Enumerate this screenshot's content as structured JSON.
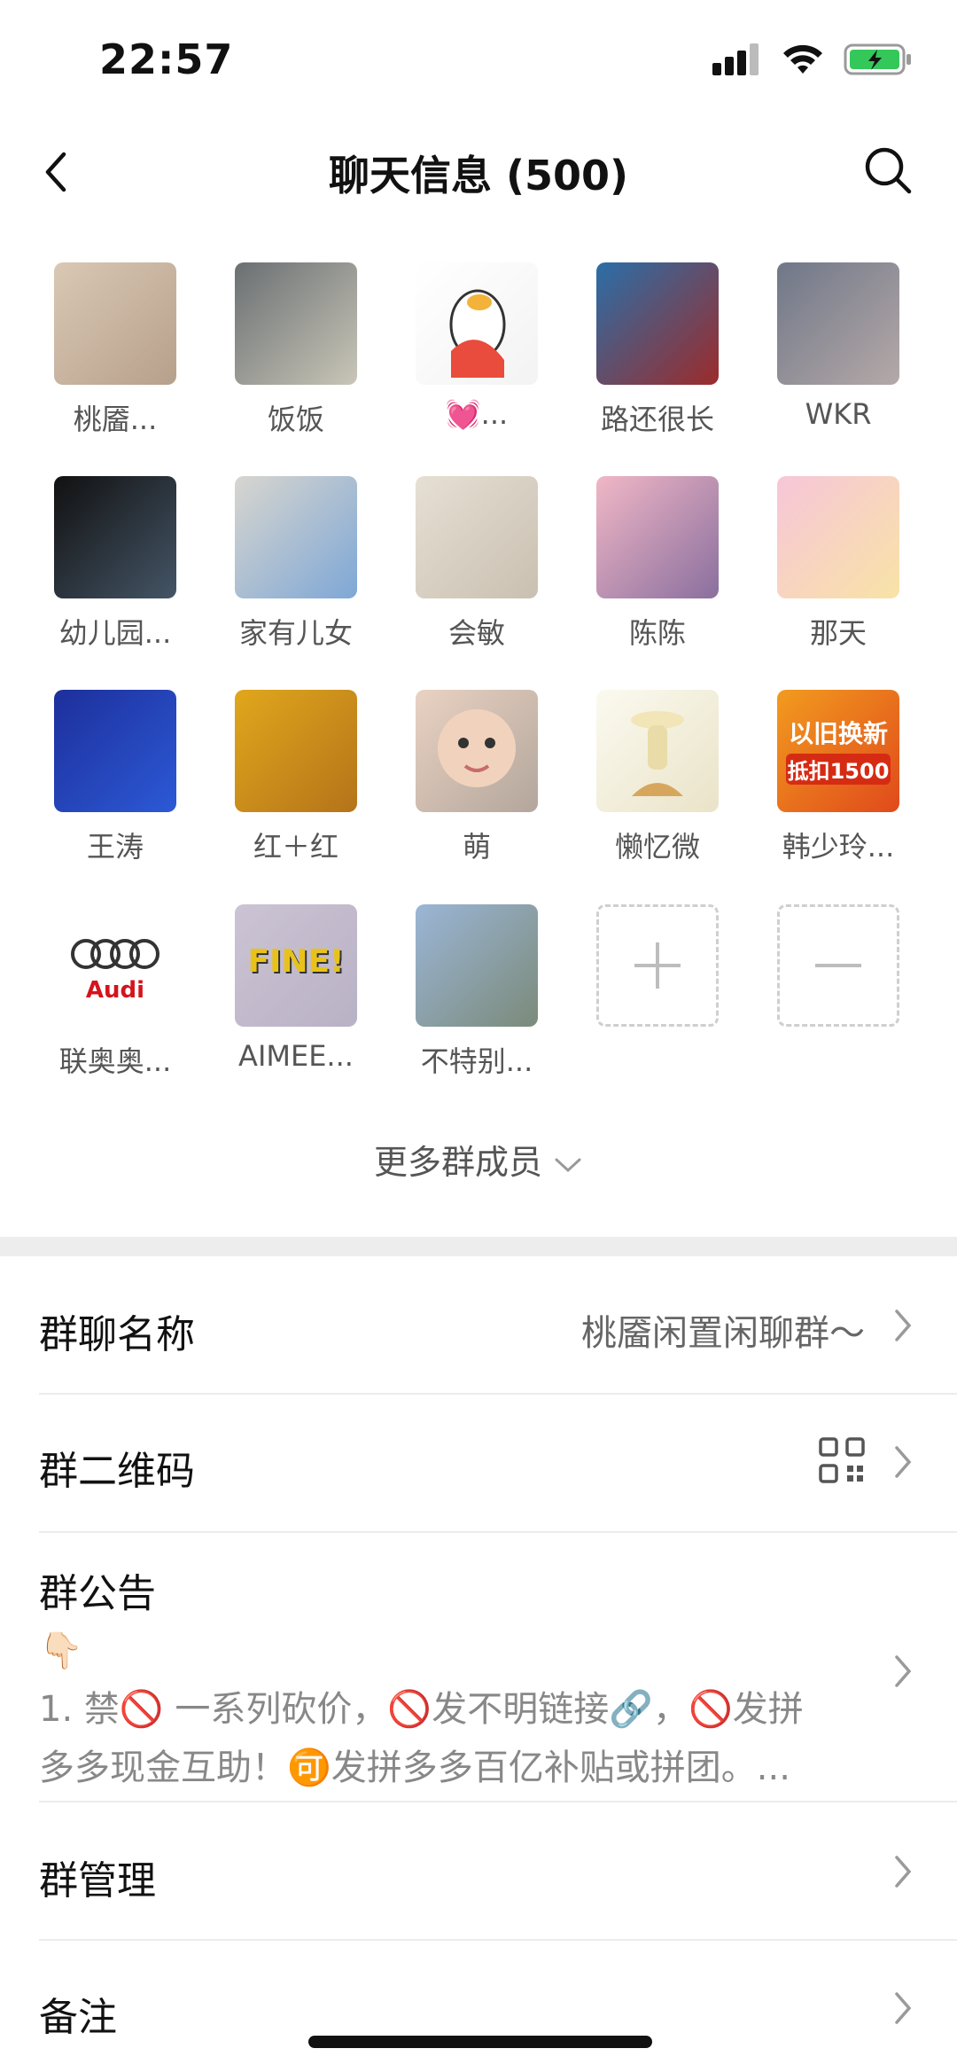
{
  "status_bar": {
    "time": "22:57"
  },
  "nav": {
    "title": "聊天信息 (500)"
  },
  "members": [
    {
      "name": "桃靥...",
      "colors": [
        "#d9c8b4",
        "#b7a08b"
      ]
    },
    {
      "name": "饭饭",
      "colors": [
        "#6a6f72",
        "#c9c6b8"
      ]
    },
    {
      "name": "💓...",
      "colors": [
        "#ffffff",
        "#f3f3f3"
      ]
    },
    {
      "name": "路还很长",
      "colors": [
        "#2a6fa8",
        "#9c2b2b"
      ]
    },
    {
      "name": "WKR",
      "colors": [
        "#6f7788",
        "#b5a9a8"
      ]
    },
    {
      "name": "幼儿园...",
      "colors": [
        "#111111",
        "#445566"
      ]
    },
    {
      "name": "家有儿女",
      "colors": [
        "#d8d6cf",
        "#7ea7d6"
      ]
    },
    {
      "name": "会敏",
      "colors": [
        "#e6dfd3",
        "#c9c0b1"
      ]
    },
    {
      "name": "陈陈",
      "colors": [
        "#f0b7c6",
        "#8a6f9e"
      ]
    },
    {
      "name": "那天",
      "colors": [
        "#f7c6d9",
        "#f8e3a6"
      ]
    },
    {
      "name": "王涛",
      "colors": [
        "#1d2f9b",
        "#2c59d6"
      ]
    },
    {
      "name": "红＋红",
      "colors": [
        "#e0a71c",
        "#b5731a"
      ]
    },
    {
      "name": "萌",
      "colors": [
        "#e9d2c2",
        "#b3a69c"
      ]
    },
    {
      "name": "懒忆微",
      "colors": [
        "#fbfaf0",
        "#eae3c8"
      ]
    },
    {
      "name": "韩少玲...",
      "colors": [
        "#f29b1e",
        "#e04a1c"
      ]
    },
    {
      "name": "联奥奥...",
      "colors": [
        "#ffffff",
        "#ffffff"
      ]
    },
    {
      "name": "AIMEE...",
      "colors": [
        "#cbc4d3",
        "#b9b1c5"
      ]
    },
    {
      "name": "不特别...",
      "colors": [
        "#9bb6d6",
        "#7b8a7a"
      ]
    }
  ],
  "avatar_texts": {
    "audi": "Audi",
    "fine": "FINE!",
    "promo_title": "以旧换新",
    "promo_sub": "抵扣1500"
  },
  "more_members": "更多群成员",
  "settings": {
    "group_name_label": "群聊名称",
    "group_name_value": "桃靥闲置闲聊群～",
    "qr_label": "群二维码",
    "notice_label": "群公告",
    "notice_emoji": "👇🏻",
    "notice_line1": "1. 禁🚫 一系列砍价，🚫发不明链接🔗，🚫发拼",
    "notice_line2": "多多现金互助！🉑发拼多多百亿补贴或拼团。...",
    "manage_label": "群管理",
    "remark_label": "备注"
  }
}
